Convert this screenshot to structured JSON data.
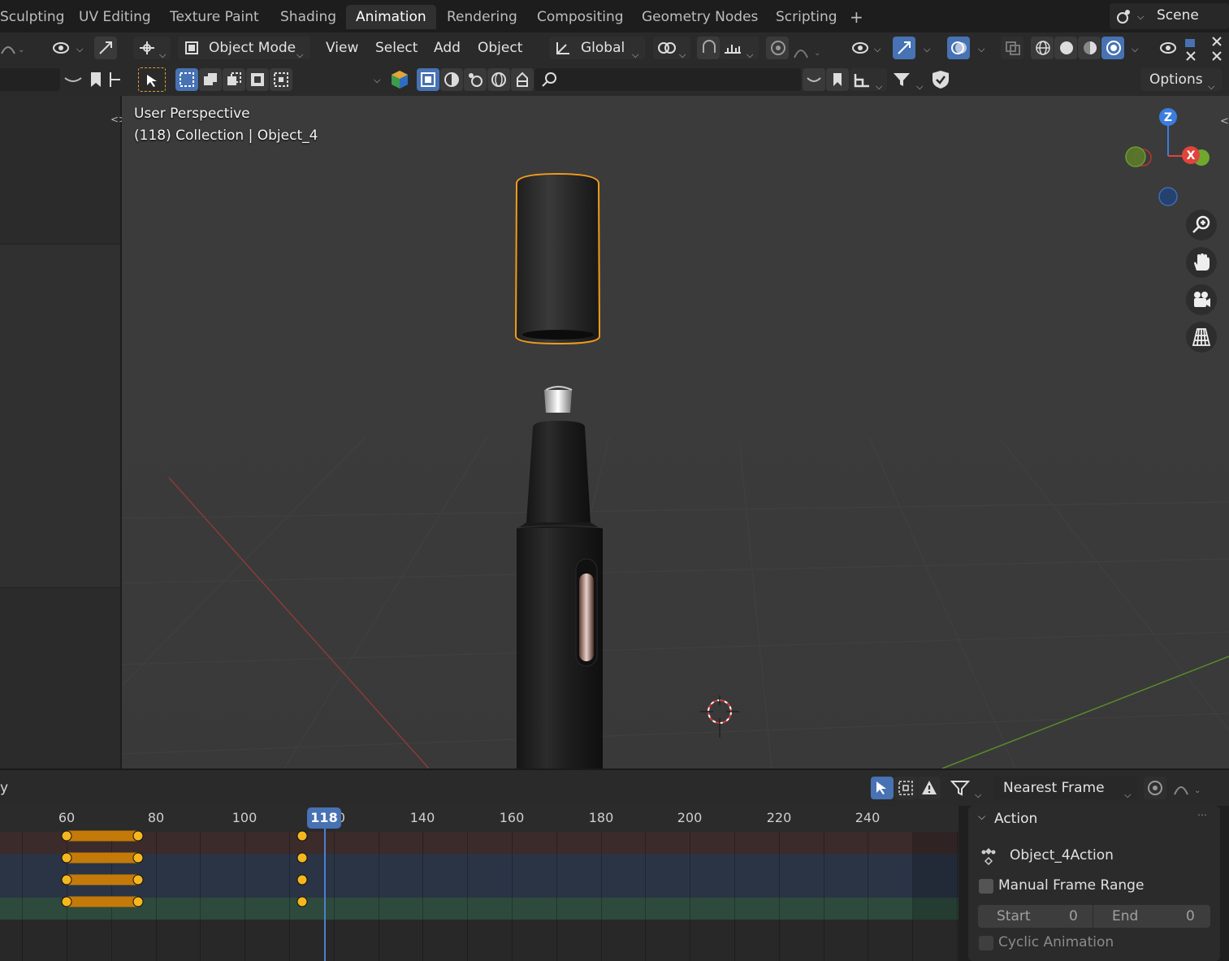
{
  "workspace_tabs": [
    {
      "label": "Sculpting"
    },
    {
      "label": "UV Editing"
    },
    {
      "label": "Texture Paint"
    },
    {
      "label": "Shading"
    },
    {
      "label": "Animation",
      "active": true
    },
    {
      "label": "Rendering"
    },
    {
      "label": "Compositing"
    },
    {
      "label": "Geometry Nodes"
    },
    {
      "label": "Scripting"
    }
  ],
  "scene": {
    "label": "Scene"
  },
  "viewport_header": {
    "mode": "Object Mode",
    "menus": [
      "View",
      "Select",
      "Add",
      "Object"
    ],
    "transform_orientation": "Global",
    "options_label": "Options"
  },
  "viewport": {
    "perspective": "User Perspective",
    "collection_info": "(118) Collection | Object_4"
  },
  "gizmo": {
    "z": "Z",
    "x": "X"
  },
  "timeline": {
    "snap_label": "Nearest Frame",
    "editor_label_fragment": "y",
    "ticks": [
      "60",
      "80",
      "100",
      "118",
      "140",
      "160",
      "180",
      "200",
      "220",
      "240"
    ],
    "current_frame": "118",
    "ticks_after_badge": "0"
  },
  "action_panel": {
    "title": "Action",
    "action_name": "Object_4Action",
    "manual_frame_range": "Manual Frame Range",
    "start_label": "Start",
    "start_value": "0",
    "end_label": "End",
    "end_value": "0",
    "cyclic": "Cyclic Animation"
  },
  "colors": {
    "accent": "#4772b3",
    "keyframe": "#f5b71d",
    "selection": "#f29b1c"
  }
}
